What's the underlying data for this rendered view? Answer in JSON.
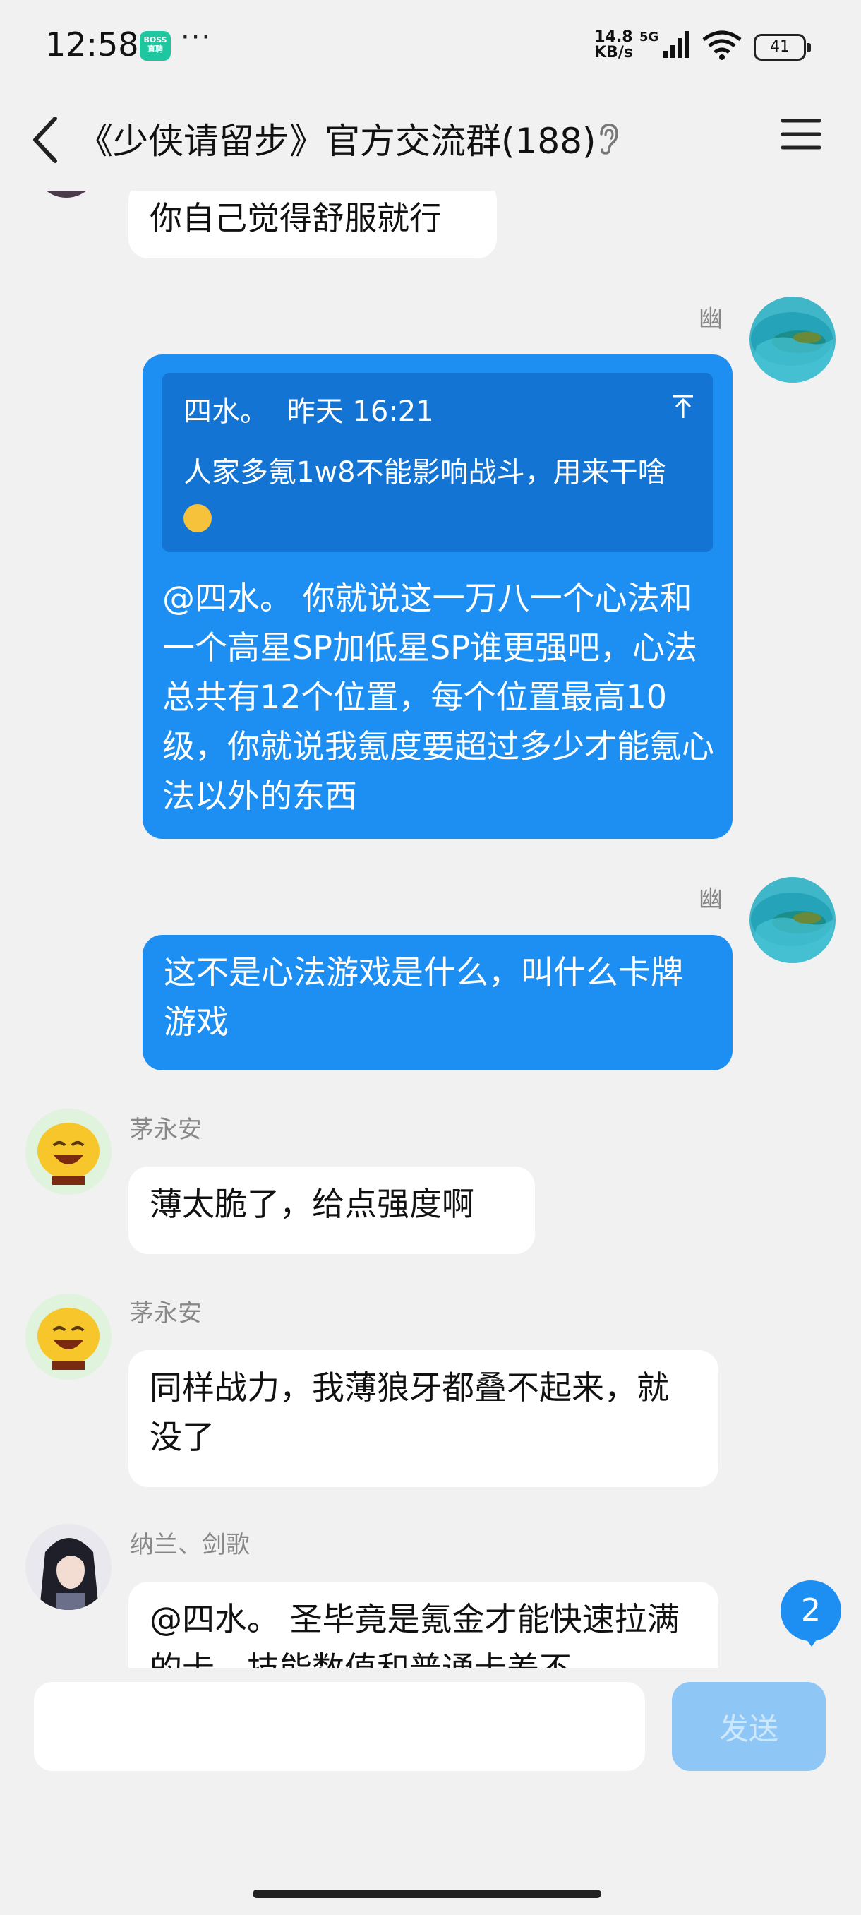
{
  "status_bar": {
    "time": "12:58",
    "boss_badge": "BOSS\n直聘",
    "dots": "···",
    "net_speed_value": "14.8",
    "net_speed_unit": "KB/s",
    "network": "5G",
    "battery": "41"
  },
  "header": {
    "title": "《少侠请留步》官方交流群(188)"
  },
  "messages": [
    {
      "text": "你自己觉得舒服就行"
    },
    {
      "sender": "幽",
      "quote": {
        "author": "四水。",
        "time": "昨天 16:21",
        "text": "人家多氪1w8不能影响战斗，用来干啥"
      },
      "text": "@四水。 你就说这一万八一个心法和一个高星SP加低星SP谁更强吧，心法总共有12个位置，每个位置最高10级，你就说我氪度要超过多少才能氪心法以外的东西"
    },
    {
      "sender": "幽",
      "text": "这不是心法游戏是什么，叫什么卡牌游戏"
    },
    {
      "sender": "茅永安",
      "text": "薄太脆了，给点强度啊"
    },
    {
      "sender": "茅永安",
      "text": "同样战力，我薄狼牙都叠不起来，就没了"
    },
    {
      "sender": "纳兰、剑歌",
      "text": "@四水。 圣毕竟是氪金才能快速拉满的卡，技能数值和普通卡差不"
    }
  ],
  "unread_count": "2",
  "input": {
    "value": "",
    "placeholder": ""
  },
  "send_label": "发送",
  "colors": {
    "bubble_self": "#1e8ff2",
    "quote_bg": "#1474d4",
    "send_disabled": "#8ec6f5"
  }
}
